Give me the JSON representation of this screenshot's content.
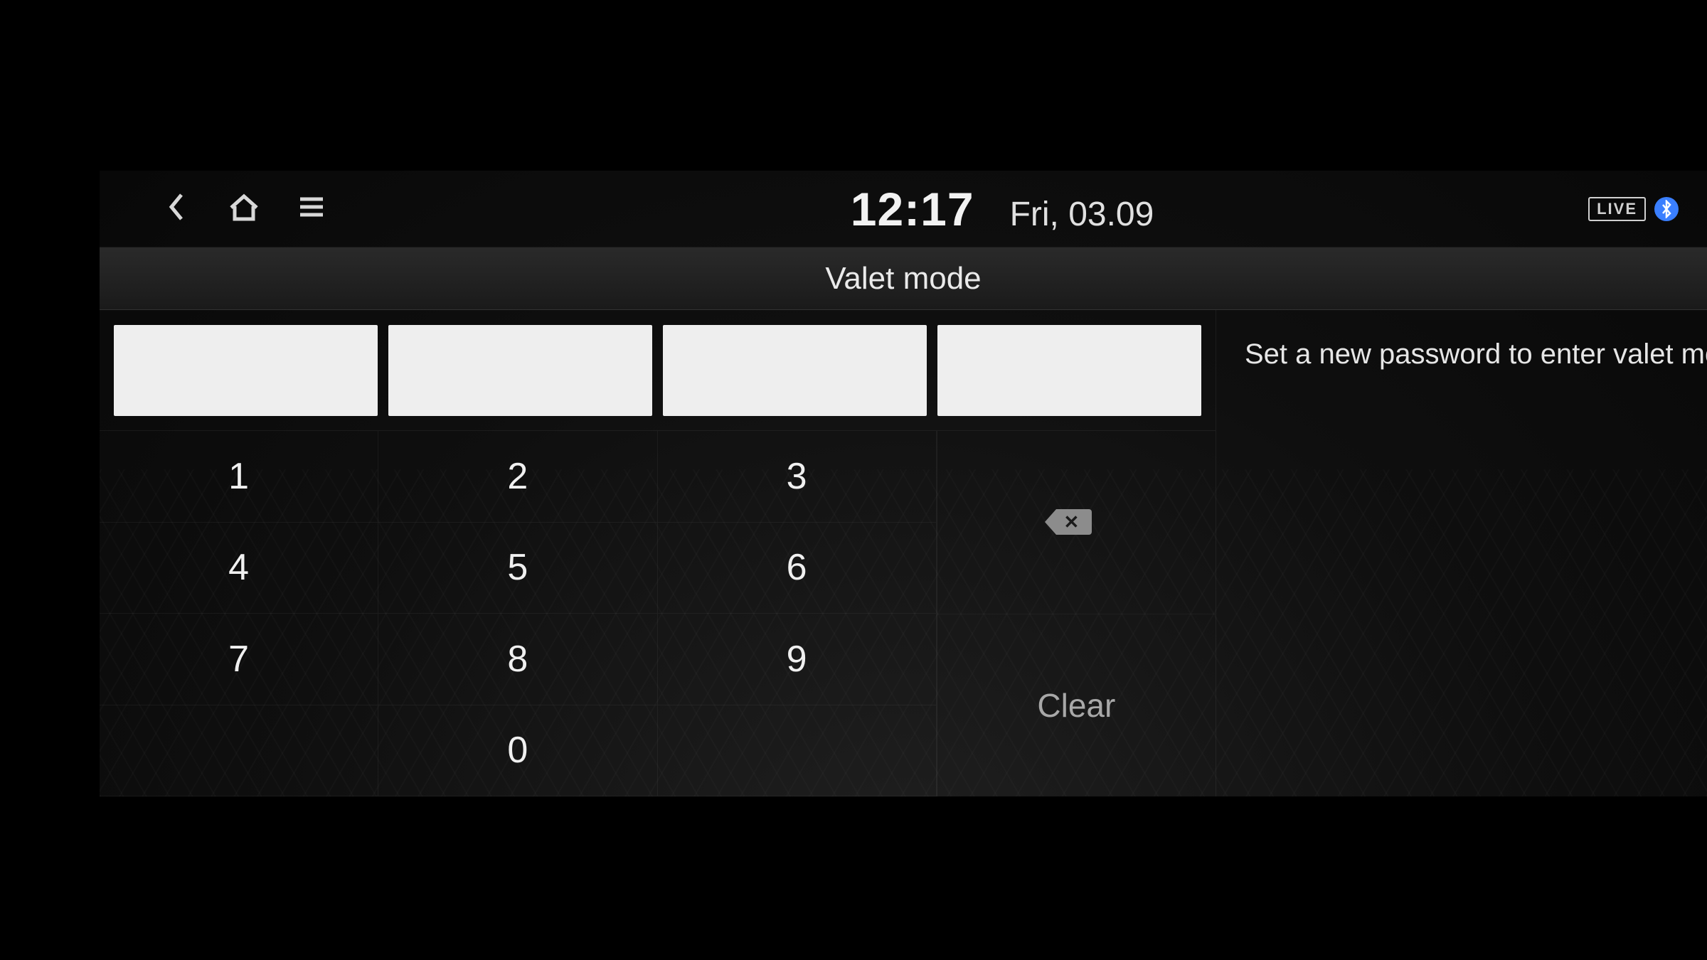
{
  "status_bar": {
    "time": "12:17",
    "date": "Fri, 03.09",
    "live_badge": "LIVE"
  },
  "page": {
    "title": "Valet mode",
    "instruction": "Set a new password to enter valet mode"
  },
  "keypad": {
    "keys": [
      "1",
      "2",
      "3",
      "4",
      "5",
      "6",
      "7",
      "8",
      "9",
      "0"
    ],
    "clear_label": "Clear"
  },
  "pin": {
    "length": 4,
    "entered": [
      "",
      "",
      "",
      ""
    ]
  }
}
